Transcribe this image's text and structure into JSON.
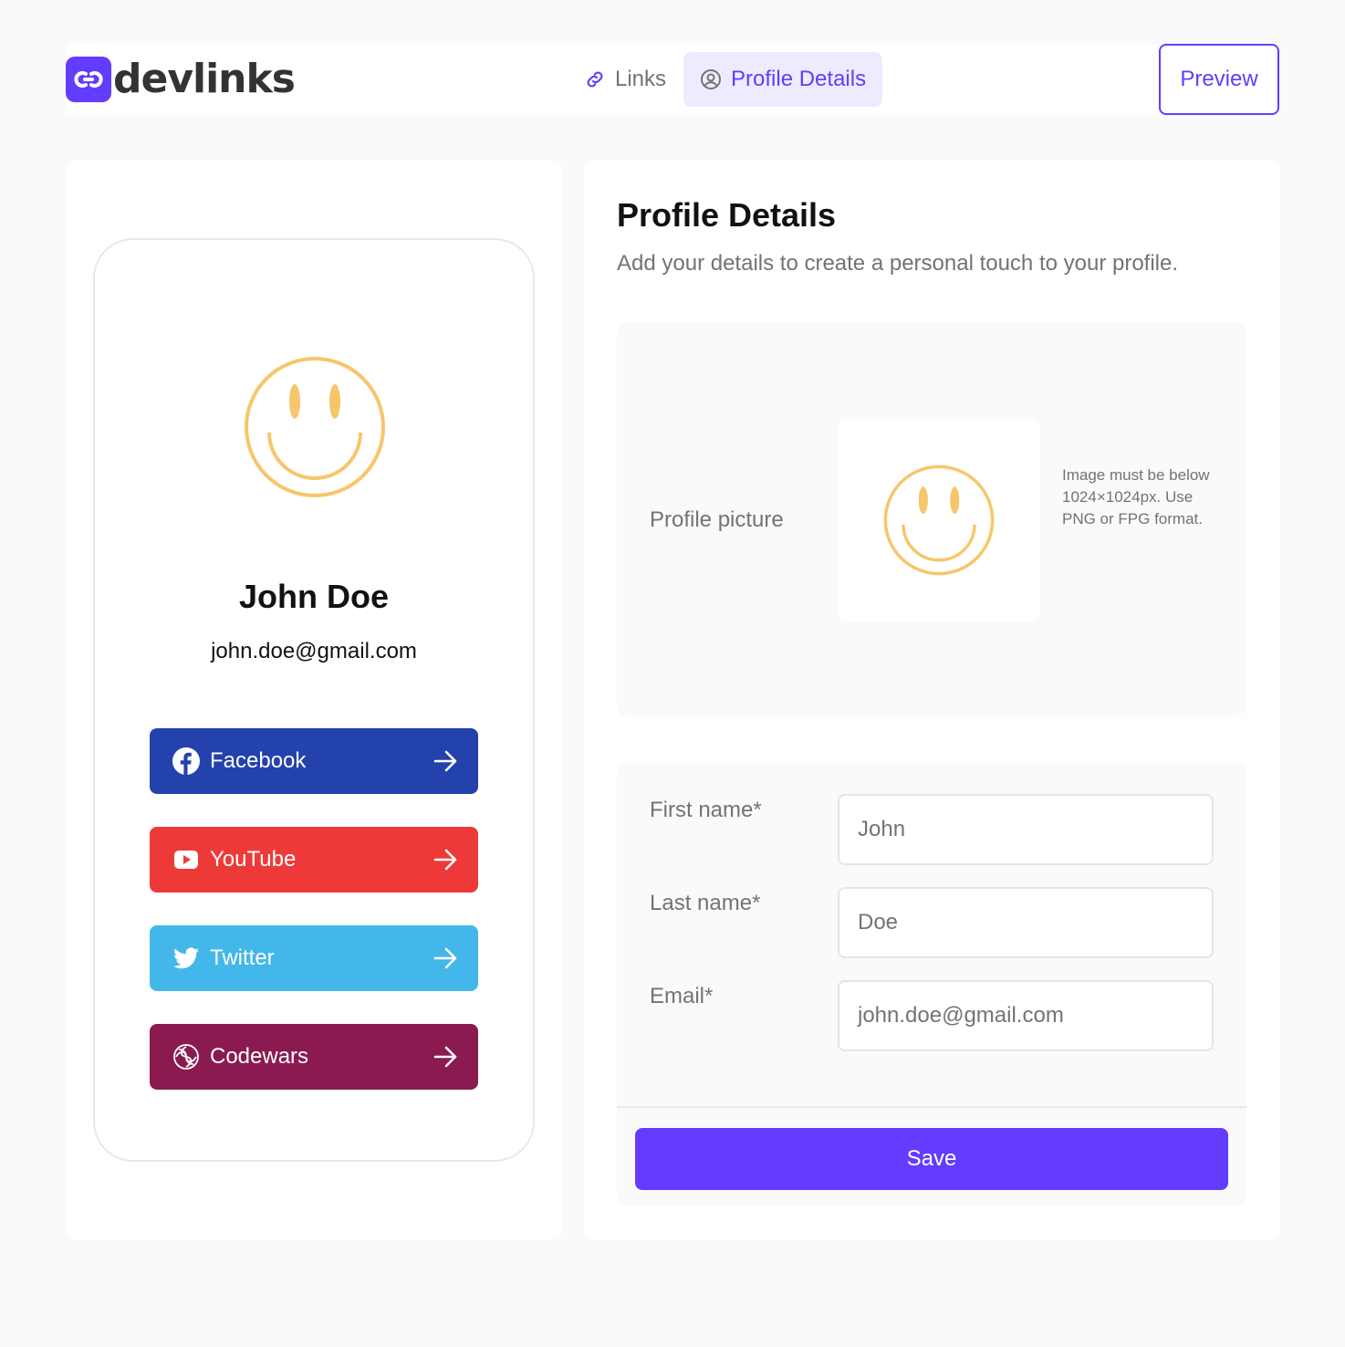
{
  "app": {
    "logo_text": "devlinks"
  },
  "nav": {
    "tabs": [
      {
        "label": "Links",
        "icon": "link-icon",
        "active": false
      },
      {
        "label": "Profile Details",
        "icon": "user-circle-icon",
        "active": true
      }
    ],
    "preview_label": "Preview"
  },
  "preview": {
    "name": "John Doe",
    "email": "john.doe@gmail.com",
    "links": [
      {
        "platform": "Facebook",
        "icon": "facebook-icon",
        "color": "#2442ac"
      },
      {
        "platform": "YouTube",
        "icon": "youtube-icon",
        "color": "#ee3939"
      },
      {
        "platform": "Twitter",
        "icon": "twitter-icon",
        "color": "#43b7e9"
      },
      {
        "platform": "Codewars",
        "icon": "codewars-icon",
        "color": "#8a1a50"
      }
    ]
  },
  "profile": {
    "title": "Profile Details",
    "subtitle": "Add your details to create a personal touch to your profile.",
    "picture_label": "Profile picture",
    "picture_hint": "Image must be below 1024×1024px. Use PNG or FPG format.",
    "fields": [
      {
        "label": "First name*",
        "value": "John"
      },
      {
        "label": "Last name*",
        "value": "Doe"
      },
      {
        "label": "Email*",
        "value": "john.doe@gmail.com"
      }
    ],
    "save_label": "Save"
  },
  "colors": {
    "accent": "#633cff",
    "accent_light": "#efebff",
    "avatar": "#f7c66b"
  }
}
